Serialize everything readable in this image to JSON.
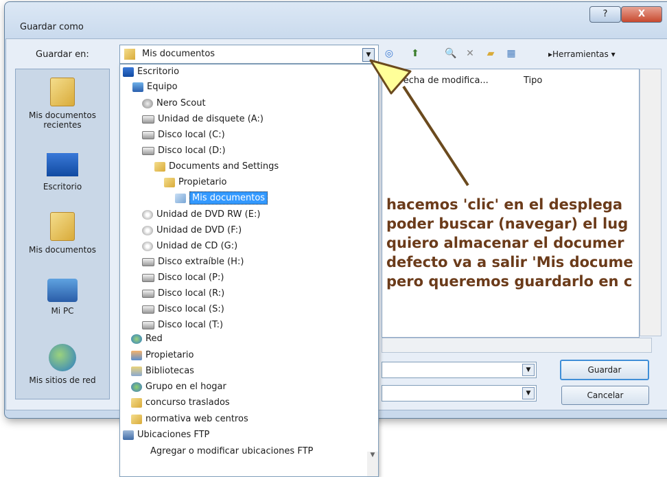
{
  "window": {
    "title": "Guardar como",
    "help": "?",
    "close": "X"
  },
  "location": {
    "label": "Guardar en:",
    "value": "Mis documentos"
  },
  "toolbar": {
    "herramientas": "Herramientas",
    "herramientas_caret": "▾"
  },
  "places": [
    {
      "label": "Mis documentos recientes",
      "icon": "recent-folder-icon"
    },
    {
      "label": "Escritorio",
      "icon": "desktop-icon"
    },
    {
      "label": "Mis documentos",
      "icon": "documents-folder-icon"
    },
    {
      "label": "Mi PC",
      "icon": "computer-icon"
    },
    {
      "label": "Mis sitios de red",
      "icon": "network-icon"
    }
  ],
  "columns": {
    "fecha": "Fecha de modifica...",
    "tipo": "Tipo"
  },
  "dropdown": [
    {
      "label": "Escritorio",
      "icon": "desk"
    },
    {
      "label": "Equipo",
      "icon": "pc"
    },
    {
      "label": "Nero Scout",
      "icon": "nero"
    },
    {
      "label": "Unidad de disquete (A:)",
      "icon": "drive"
    },
    {
      "label": "Disco local (C:)",
      "icon": "drive"
    },
    {
      "label": "Disco local (D:)",
      "icon": "drive"
    },
    {
      "label": "Documents and Settings",
      "icon": "fold"
    },
    {
      "label": "Propietario",
      "icon": "fold"
    },
    {
      "label": "Mis documentos",
      "icon": "fold",
      "selected": true
    },
    {
      "label": "Unidad de DVD RW (E:)",
      "icon": "dvd"
    },
    {
      "label": "Unidad de DVD (F:)",
      "icon": "dvd"
    },
    {
      "label": "Unidad de CD (G:)",
      "icon": "dvd"
    },
    {
      "label": "Disco extraíble (H:)",
      "icon": "drive"
    },
    {
      "label": "Disco local (P:)",
      "icon": "drive"
    },
    {
      "label": "Disco local (R:)",
      "icon": "drive"
    },
    {
      "label": "Disco local (S:)",
      "icon": "drive"
    },
    {
      "label": "Disco local (T:)",
      "icon": "drive"
    },
    {
      "label": "Red",
      "icon": "net"
    },
    {
      "label": "Propietario",
      "icon": "user"
    },
    {
      "label": "Bibliotecas",
      "icon": "lib"
    },
    {
      "label": "Grupo en el hogar",
      "icon": "home"
    },
    {
      "label": "concurso traslados",
      "icon": "fold"
    },
    {
      "label": "normativa web centros",
      "icon": "fold"
    },
    {
      "label": "Ubicaciones FTP",
      "icon": "ftp"
    },
    {
      "label": "Agregar o modificar ubicaciones FTP",
      "icon": ""
    }
  ],
  "buttons": {
    "guardar": "Guardar",
    "cancelar": "Cancelar"
  },
  "annotation": [
    "hacemos 'clic' en el desplega",
    "poder buscar (navegar) el lug",
    "quiero almacenar el documer",
    "defecto va a salir 'Mis docume",
    "pero queremos guardarlo en c"
  ],
  "colors": {
    "annotation_text": "#6b3b1a",
    "arrow_fill": "#ffff99",
    "arrow_stroke": "#6b4a1e",
    "selection": "#3399ff"
  }
}
